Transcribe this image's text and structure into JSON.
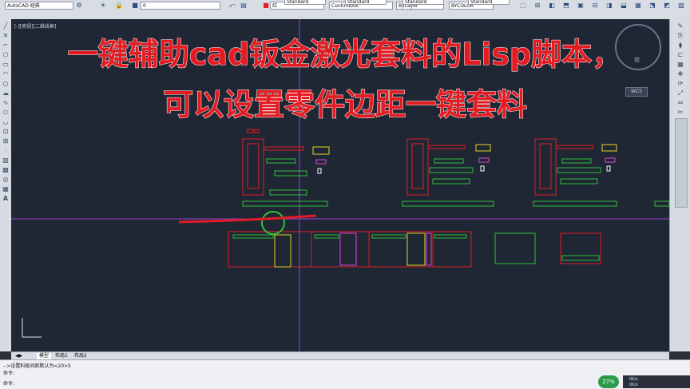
{
  "toolbar": {
    "workspace": "AutoCAD 经典",
    "layer": "0",
    "text_style": "Standard",
    "dim_style": "Standard",
    "table_style": "Standard",
    "multileader_style": "Standard",
    "color": "红",
    "linetype": "Continuous",
    "lineweight": "ByLayer",
    "plot_style": "BYCOLOR"
  },
  "viewport": {
    "label": "[-][俯视][二维线框]"
  },
  "viewcube": {
    "south": "南",
    "wcs": "WCS"
  },
  "overlay": {
    "line1": "一键辅助cad钣金激光套料的Lisp脚本，",
    "line2": "可以设置零件边距一键套料"
  },
  "tabs": [
    "模型",
    "布局1",
    "布局2"
  ],
  "command": {
    "history": "-->设置料板间距默认为<20>5",
    "prompt1": "命令:",
    "prompt2": "命令:"
  },
  "status": {
    "percent": "27%"
  },
  "network": {
    "up": "0K/s",
    "down": "0K/s"
  },
  "colors": {
    "accent_red": "#e31c23",
    "viewport_bg": "#1f2634",
    "crosshair": "#9a42d6"
  }
}
